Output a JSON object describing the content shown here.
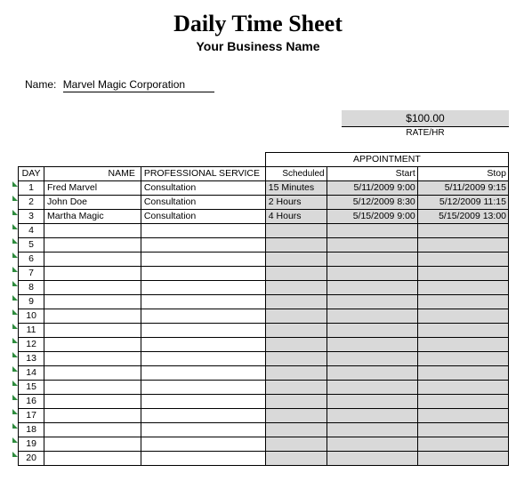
{
  "header": {
    "title": "Daily Time Sheet",
    "subtitle": "Your Business Name"
  },
  "name_field": {
    "label": "Name:",
    "value": "Marvel Magic Corporation"
  },
  "rate": {
    "amount": "$100.00",
    "label": "RATE/HR"
  },
  "columns": {
    "day": "DAY",
    "name": "NAME",
    "service": "PROFESSIONAL SERVICE",
    "appointment": "APPOINTMENT",
    "scheduled": "Scheduled",
    "start": "Start",
    "stop": "Stop"
  },
  "chart_data": {
    "type": "table",
    "title": "Daily Time Sheet",
    "rows": [
      {
        "day": "1",
        "name": "Fred Marvel",
        "service": "Consultation",
        "scheduled": "15 Minutes",
        "start": "5/11/2009 9:00",
        "stop": "5/11/2009 9:15"
      },
      {
        "day": "2",
        "name": "John Doe",
        "service": "Consultation",
        "scheduled": "2 Hours",
        "start": "5/12/2009 8:30",
        "stop": "5/12/2009 11:15"
      },
      {
        "day": "3",
        "name": "Martha Magic",
        "service": "Consultation",
        "scheduled": "4 Hours",
        "start": "5/15/2009 9:00",
        "stop": "5/15/2009 13:00"
      },
      {
        "day": "4",
        "name": "",
        "service": "",
        "scheduled": "",
        "start": "",
        "stop": ""
      },
      {
        "day": "5",
        "name": "",
        "service": "",
        "scheduled": "",
        "start": "",
        "stop": ""
      },
      {
        "day": "6",
        "name": "",
        "service": "",
        "scheduled": "",
        "start": "",
        "stop": ""
      },
      {
        "day": "7",
        "name": "",
        "service": "",
        "scheduled": "",
        "start": "",
        "stop": ""
      },
      {
        "day": "8",
        "name": "",
        "service": "",
        "scheduled": "",
        "start": "",
        "stop": ""
      },
      {
        "day": "9",
        "name": "",
        "service": "",
        "scheduled": "",
        "start": "",
        "stop": ""
      },
      {
        "day": "10",
        "name": "",
        "service": "",
        "scheduled": "",
        "start": "",
        "stop": ""
      },
      {
        "day": "11",
        "name": "",
        "service": "",
        "scheduled": "",
        "start": "",
        "stop": ""
      },
      {
        "day": "12",
        "name": "",
        "service": "",
        "scheduled": "",
        "start": "",
        "stop": ""
      },
      {
        "day": "13",
        "name": "",
        "service": "",
        "scheduled": "",
        "start": "",
        "stop": ""
      },
      {
        "day": "14",
        "name": "",
        "service": "",
        "scheduled": "",
        "start": "",
        "stop": ""
      },
      {
        "day": "15",
        "name": "",
        "service": "",
        "scheduled": "",
        "start": "",
        "stop": ""
      },
      {
        "day": "16",
        "name": "",
        "service": "",
        "scheduled": "",
        "start": "",
        "stop": ""
      },
      {
        "day": "17",
        "name": "",
        "service": "",
        "scheduled": "",
        "start": "",
        "stop": ""
      },
      {
        "day": "18",
        "name": "",
        "service": "",
        "scheduled": "",
        "start": "",
        "stop": ""
      },
      {
        "day": "19",
        "name": "",
        "service": "",
        "scheduled": "",
        "start": "",
        "stop": ""
      },
      {
        "day": "20",
        "name": "",
        "service": "",
        "scheduled": "",
        "start": "",
        "stop": ""
      }
    ]
  }
}
